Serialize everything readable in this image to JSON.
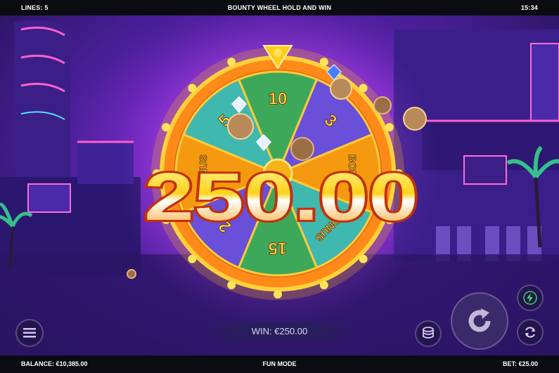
{
  "top_bar": {
    "lines_label": "LINES: 5",
    "game_title": "BOUNTY WHEEL HOLD AND WIN",
    "clock": "15:34"
  },
  "wheel": {
    "segments": [
      "10",
      "3",
      "BONUS",
      "BONUS",
      "15",
      "2",
      "BONUS",
      "5"
    ]
  },
  "big_win_amount": "250.00",
  "win_display": {
    "text": "WIN: €250.00"
  },
  "bottom_bar": {
    "balance": "BALANCE: €10,385.00",
    "mode": "FUN MODE",
    "bet": "BET: €25.00"
  },
  "colors": {
    "bar_bg": "#0b0b12",
    "wheel_rim": "#f39a1c",
    "win_text": "#ffd21a",
    "turbo": "#38d35a"
  },
  "icons": [
    "menu-icon",
    "coin-stack-icon",
    "spin-icon",
    "autoplay-icon",
    "turbo-icon"
  ]
}
